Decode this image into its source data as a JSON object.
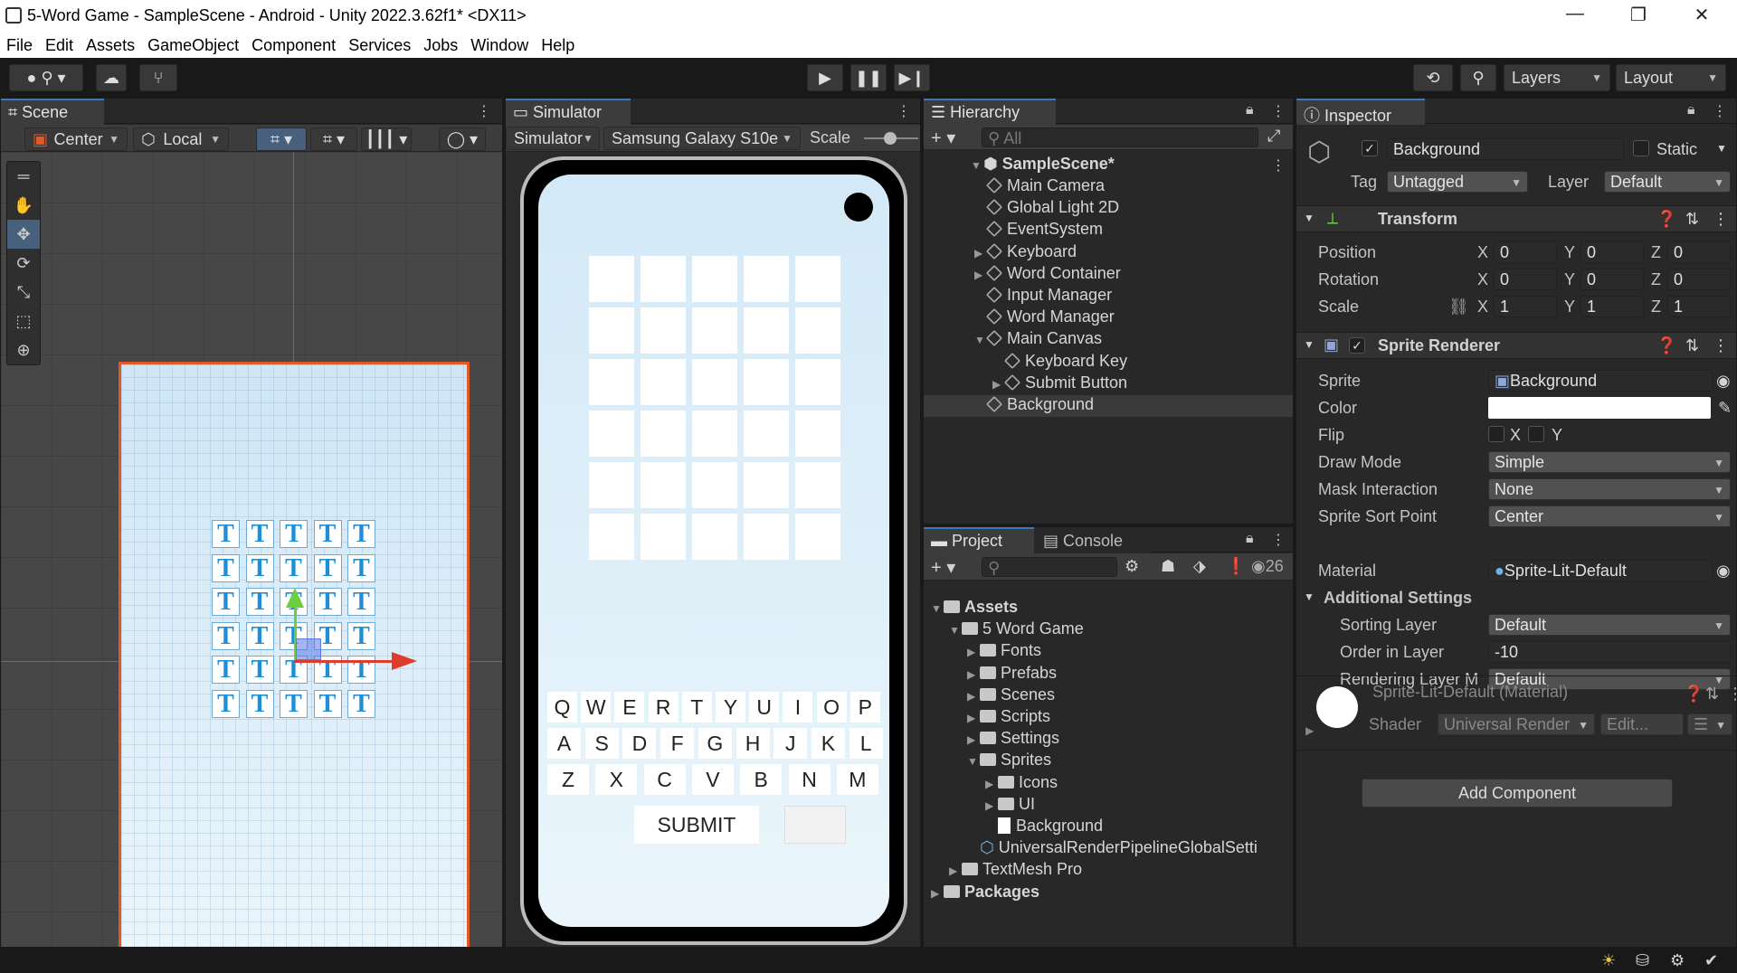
{
  "window": {
    "title": "5-Word Game - SampleScene - Android - Unity 2022.3.62f1* <DX11>",
    "controls": [
      "—",
      "❐",
      "✕"
    ]
  },
  "menu": [
    "File",
    "Edit",
    "Assets",
    "GameObject",
    "Component",
    "Services",
    "Jobs",
    "Window",
    "Help"
  ],
  "toolbar": {
    "layers": "Layers",
    "layout": "Layout"
  },
  "scene": {
    "tab": "Scene",
    "pivot": "Center",
    "space": "Local",
    "letter": "T",
    "grid_rows": 6,
    "grid_cols": 5
  },
  "simulator": {
    "tab": "Simulator",
    "mode": "Simulator",
    "device": "Samsung Galaxy S10e",
    "scale_label": "Scale",
    "keyboard_rows": [
      [
        "Q",
        "W",
        "E",
        "R",
        "T",
        "Y",
        "U",
        "I",
        "O",
        "P"
      ],
      [
        "A",
        "S",
        "D",
        "F",
        "G",
        "H",
        "J",
        "K",
        "L"
      ],
      [
        "Z",
        "X",
        "C",
        "V",
        "B",
        "N",
        "M"
      ]
    ],
    "submit": "SUBMIT"
  },
  "hierarchy": {
    "tab": "Hierarchy",
    "search_placeholder": "All",
    "scene": "SampleScene*",
    "items": [
      "Main Camera",
      "Global Light 2D",
      "EventSystem",
      "Keyboard",
      "Word Container",
      "Input Manager",
      "Word Manager",
      "Main Canvas",
      "Keyboard Key",
      "Submit Button",
      "Background"
    ]
  },
  "project": {
    "tab_project": "Project",
    "tab_console": "Console",
    "count": "26",
    "tree": [
      "Assets",
      "5 Word Game",
      "Fonts",
      "Prefabs",
      "Scenes",
      "Scripts",
      "Settings",
      "Sprites",
      "Icons",
      "UI",
      "Background",
      "UniversalRenderPipelineGlobalSetti",
      "TextMesh Pro",
      "Packages"
    ]
  },
  "inspector": {
    "tab": "Inspector",
    "object_name": "Background",
    "static_label": "Static",
    "tag_label": "Tag",
    "tag": "Untagged",
    "layer_label": "Layer",
    "layer": "Default",
    "transform": {
      "title": "Transform",
      "position_label": "Position",
      "rotation_label": "Rotation",
      "scale_label": "Scale",
      "position": [
        "0",
        "0",
        "0"
      ],
      "rotation": [
        "0",
        "0",
        "0"
      ],
      "scale": [
        "1",
        "1",
        "1"
      ]
    },
    "sprite_renderer": {
      "title": "Sprite Renderer",
      "sprite_label": "Sprite",
      "sprite": "Background",
      "color_label": "Color",
      "flip_label": "Flip",
      "draw_mode_label": "Draw Mode",
      "draw_mode": "Simple",
      "mask_label": "Mask Interaction",
      "mask": "None",
      "sort_point_label": "Sprite Sort Point",
      "sort_point": "Center",
      "material_label": "Material",
      "material": "Sprite-Lit-Default",
      "additional": "Additional Settings",
      "sorting_layer_label": "Sorting Layer",
      "sorting_layer": "Default",
      "order_label": "Order in Layer",
      "order": "-10",
      "rendering_layer_label": "Rendering Layer M",
      "rendering_layer": "Default"
    },
    "material_block": {
      "title": "Sprite-Lit-Default (Material)",
      "shader_label": "Shader",
      "shader": "Universal Render",
      "edit": "Edit..."
    },
    "add_component": "Add Component"
  },
  "colors": {
    "accent": "#3a79bb",
    "selection": "#46607e",
    "canvas_border": "#e05a28",
    "letter": "#1d8fd9"
  }
}
